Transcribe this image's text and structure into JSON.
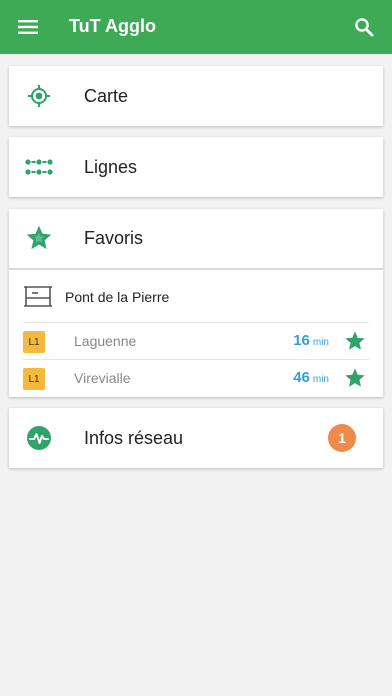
{
  "appbar": {
    "title": "TuT Agglo",
    "menu_icon": "hamburger-menu-icon",
    "search_icon": "search-icon",
    "color": "#3faa56"
  },
  "nav": {
    "carte": {
      "label": "Carte",
      "icon": "location-target-icon"
    },
    "lignes": {
      "label": "Lignes",
      "icon": "bus-lines-icon"
    }
  },
  "favoris": {
    "label": "Favoris",
    "icon": "star-icon",
    "stop": {
      "name": "Pont de la Pierre",
      "icon": "bus-stop-icon"
    },
    "departures": [
      {
        "line": "L1",
        "destination": "Laguenne",
        "minutes": "16",
        "unit": "min"
      },
      {
        "line": "L1",
        "destination": "Virevialle",
        "minutes": "46",
        "unit": "min"
      }
    ]
  },
  "infos": {
    "label": "Infos réseau",
    "icon": "network-pulse-icon",
    "count": "1"
  },
  "colors": {
    "accent_green": "#2fa36a",
    "minutes_blue": "#3a9dd6",
    "line_badge": "#f5b93e",
    "notification": "#f08a4b"
  }
}
